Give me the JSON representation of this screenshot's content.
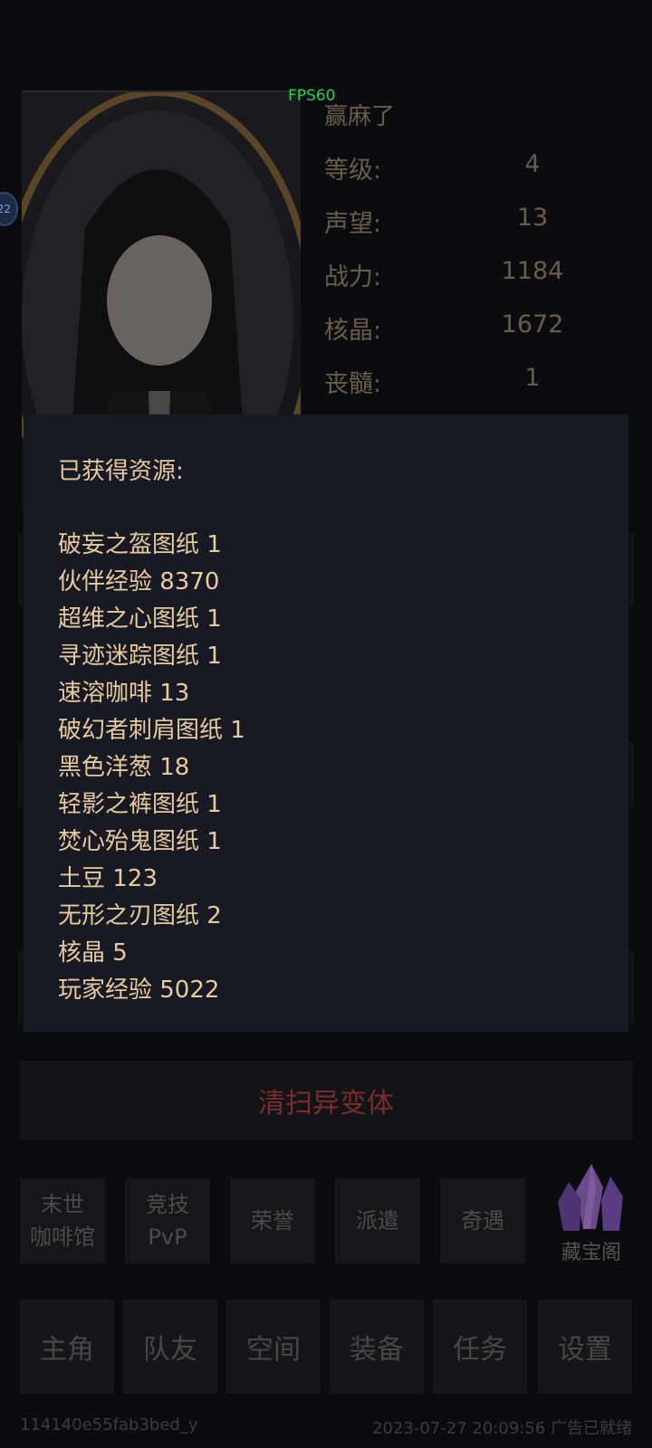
{
  "fps_label": "FPS60",
  "side_badge": "22",
  "player": {
    "name": "赢麻了",
    "stats": [
      {
        "label": "等级:",
        "value": "4"
      },
      {
        "label": "声望:",
        "value": "13"
      },
      {
        "label": "战力:",
        "value": "1184"
      },
      {
        "label": "核晶:",
        "value": "1672"
      },
      {
        "label": "丧髓:",
        "value": "1"
      }
    ]
  },
  "modal": {
    "title": "已获得资源:",
    "items": [
      "破妄之盔图纸 1",
      "伙伴经验 8370",
      "超维之心图纸 1",
      "寻迹迷踪图纸 1",
      "速溶咖啡 13",
      "破幻者刺肩图纸 1",
      "黑色洋葱 18",
      "轻影之裤图纸 1",
      "焚心殆鬼图纸 1",
      "土豆 123",
      "无形之刃图纸 2",
      "核晶 5",
      "玩家经验 5022"
    ]
  },
  "main_action": "清扫异变体",
  "features": [
    {
      "line1": "末世",
      "line2": "咖啡馆"
    },
    {
      "line1": "竞技",
      "line2": "PvP"
    },
    {
      "line1": "荣誉",
      "line2": ""
    },
    {
      "line1": "派遣",
      "line2": ""
    },
    {
      "line1": "奇遇",
      "line2": ""
    }
  ],
  "treasure_label": "藏宝阁",
  "nav": [
    "主角",
    "队友",
    "空间",
    "装备",
    "任务",
    "设置"
  ],
  "footer": {
    "device_id": "114140e55fab3bed_y",
    "status": "2023-07-27 20:09:56 广告已就绪"
  },
  "colors": {
    "modal_text": "#e8c9a0",
    "fps": "#2bd04a",
    "action_text": "#7a2c2c"
  }
}
